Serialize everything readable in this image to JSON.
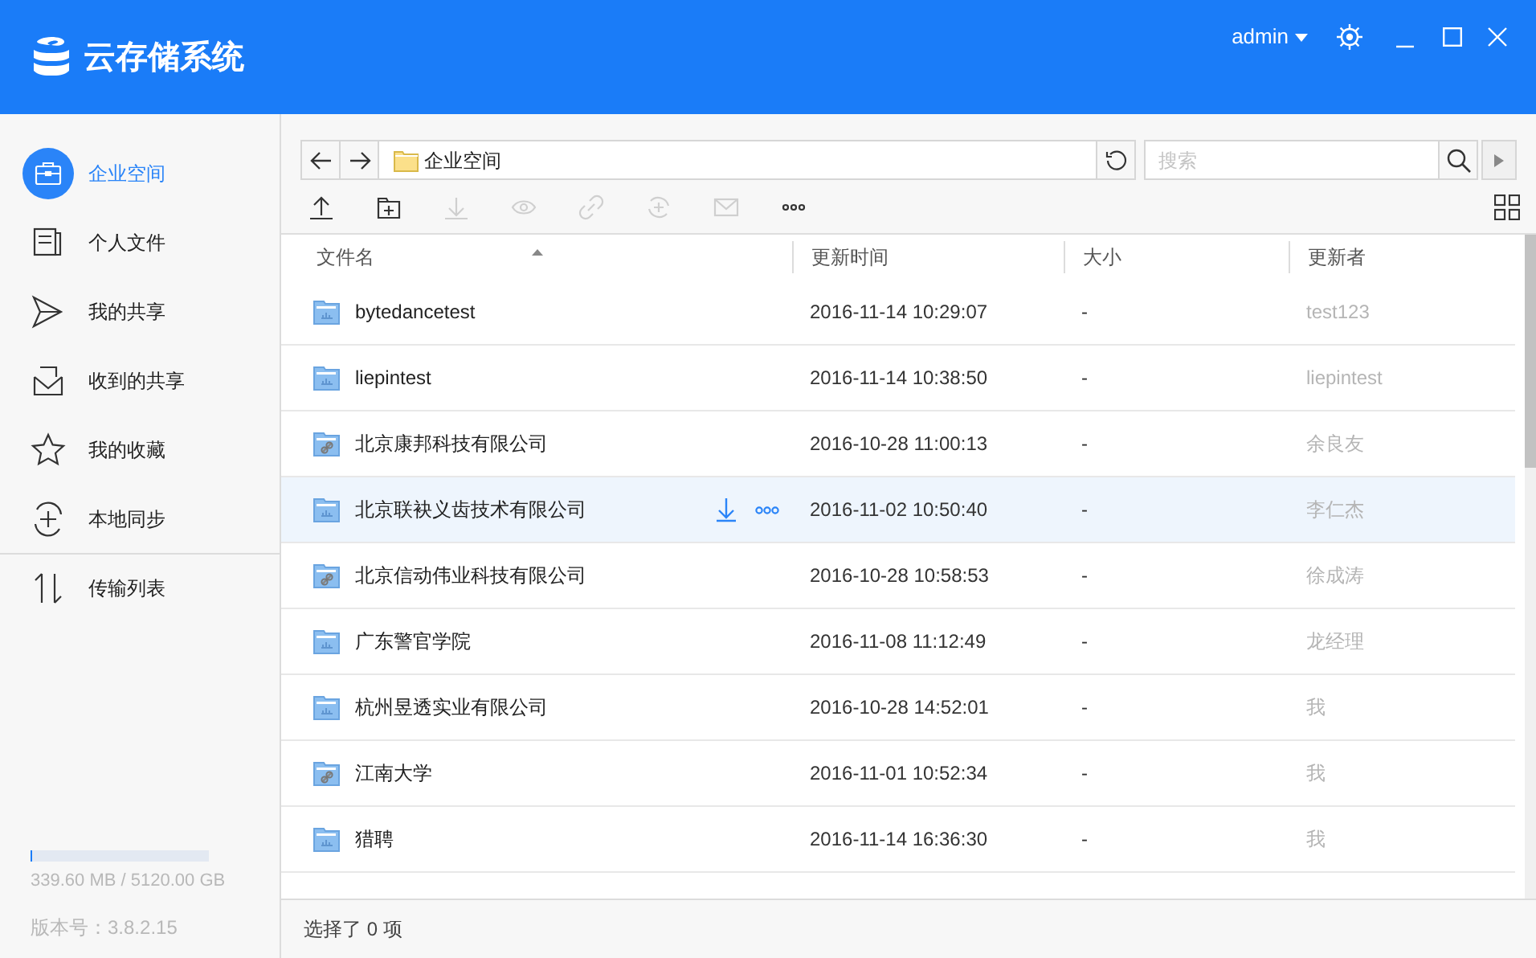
{
  "header": {
    "app_title": "云存储系统",
    "user": "admin"
  },
  "sidebar": {
    "items": [
      {
        "label": "企业空间",
        "selected": true
      },
      {
        "label": "个人文件",
        "selected": false
      },
      {
        "label": "我的共享",
        "selected": false
      },
      {
        "label": "收到的共享",
        "selected": false
      },
      {
        "label": "我的收藏",
        "selected": false
      },
      {
        "label": "本地同步",
        "selected": false
      },
      {
        "label": "传输列表",
        "selected": false
      }
    ],
    "storage": {
      "level": 0.01,
      "text": "339.60 MB / 5120.00 GB"
    },
    "version": "版本号：3.8.2.15"
  },
  "address_bar": {
    "path": "企业空间",
    "search_placeholder": "搜索"
  },
  "toolbar": [
    {
      "disabled": false
    },
    {
      "disabled": false
    },
    {
      "disabled": true
    },
    {
      "disabled": true
    },
    {
      "disabled": true
    },
    {
      "disabled": true
    },
    {
      "disabled": true
    },
    {
      "disabled": false
    }
  ],
  "table": {
    "columns": [
      {
        "label": "文件名",
        "sorted": true
      },
      {
        "label": "更新时间",
        "sorted": false
      },
      {
        "label": "大小",
        "sorted": false
      },
      {
        "label": "更新者",
        "sorted": false
      }
    ],
    "rows": [
      {
        "kind": "plain",
        "name": "bytedancetest",
        "time": "2016-11-14 10:29:07",
        "size": "-",
        "updater": "test123",
        "hovered": false
      },
      {
        "kind": "plain",
        "name": "liepintest",
        "time": "2016-11-14 10:38:50",
        "size": "-",
        "updater": "liepintest",
        "hovered": false
      },
      {
        "kind": "shared",
        "name": "北京康邦科技有限公司",
        "time": "2016-10-28 11:00:13",
        "size": "-",
        "updater": "余良友",
        "hovered": false
      },
      {
        "kind": "plain",
        "name": "北京联袂义齿技术有限公司",
        "time": "2016-11-02 10:50:40",
        "size": "-",
        "updater": "李仁杰",
        "hovered": true
      },
      {
        "kind": "shared",
        "name": "北京信动伟业科技有限公司",
        "time": "2016-10-28 10:58:53",
        "size": "-",
        "updater": "徐成涛",
        "hovered": false
      },
      {
        "kind": "plain",
        "name": "广东警官学院",
        "time": "2016-11-08 11:12:49",
        "size": "-",
        "updater": "龙经理",
        "hovered": false
      },
      {
        "kind": "plain",
        "name": "杭州昱透实业有限公司",
        "time": "2016-10-28 14:52:01",
        "size": "-",
        "updater": "我",
        "hovered": false
      },
      {
        "kind": "shared",
        "name": "江南大学",
        "time": "2016-11-01 10:52:34",
        "size": "-",
        "updater": "我",
        "hovered": false
      },
      {
        "kind": "plain",
        "name": "猎聘",
        "time": "2016-11-14 16:36:30",
        "size": "-",
        "updater": "我",
        "hovered": false
      }
    ]
  },
  "status_bar": "选择了 0 项"
}
